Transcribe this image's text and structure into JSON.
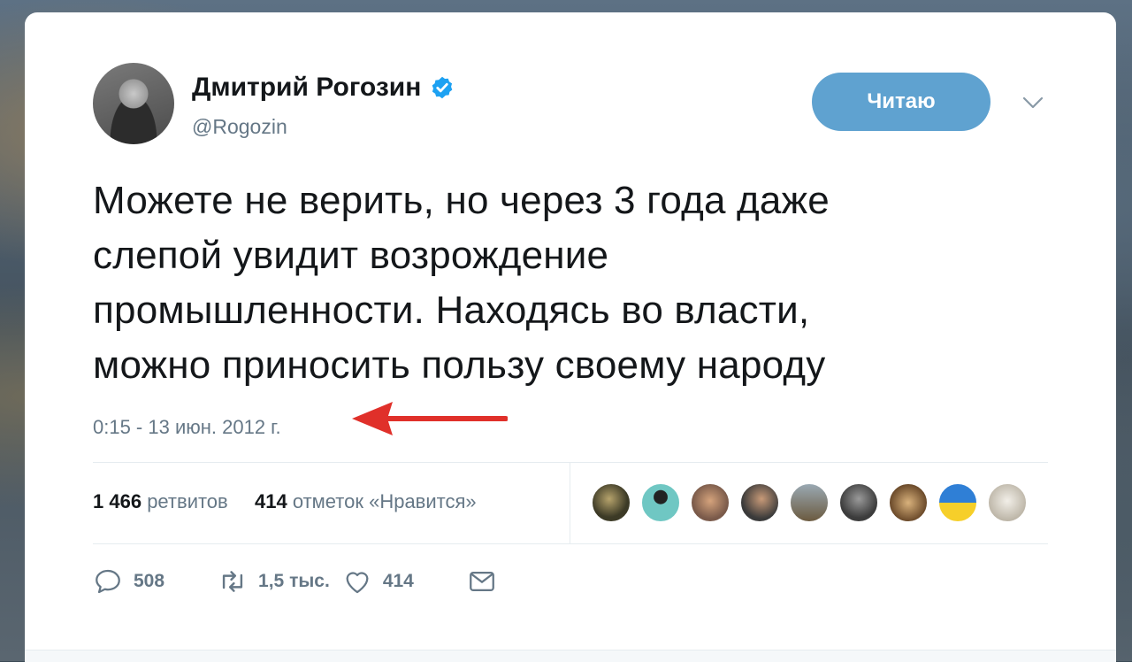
{
  "author": {
    "name": "Дмитрий Рогозин",
    "handle": "@Rogozin"
  },
  "follow_button": {
    "label": "Читаю"
  },
  "tweet": {
    "lines": [
      "Можете не верить, но через 3 года даже",
      "слепой увидит возрождение",
      "промышленности. Находясь во власти,",
      "можно приносить пользу своему народу"
    ],
    "timestamp": "0:15 - 13 июн. 2012 г."
  },
  "stats": {
    "retweets_count": "1 466",
    "retweets_label": "ретвитов",
    "likes_count": "414",
    "likes_label": "отметок «Нравится»"
  },
  "actions": {
    "reply_count": "508",
    "retweet_count": "1,5 тыс.",
    "like_count": "414"
  },
  "colors": {
    "follow_button": "#5fa2d0",
    "verified_badge": "#1da1f2",
    "annotation_arrow": "#e0302a",
    "muted_text": "#657786"
  }
}
